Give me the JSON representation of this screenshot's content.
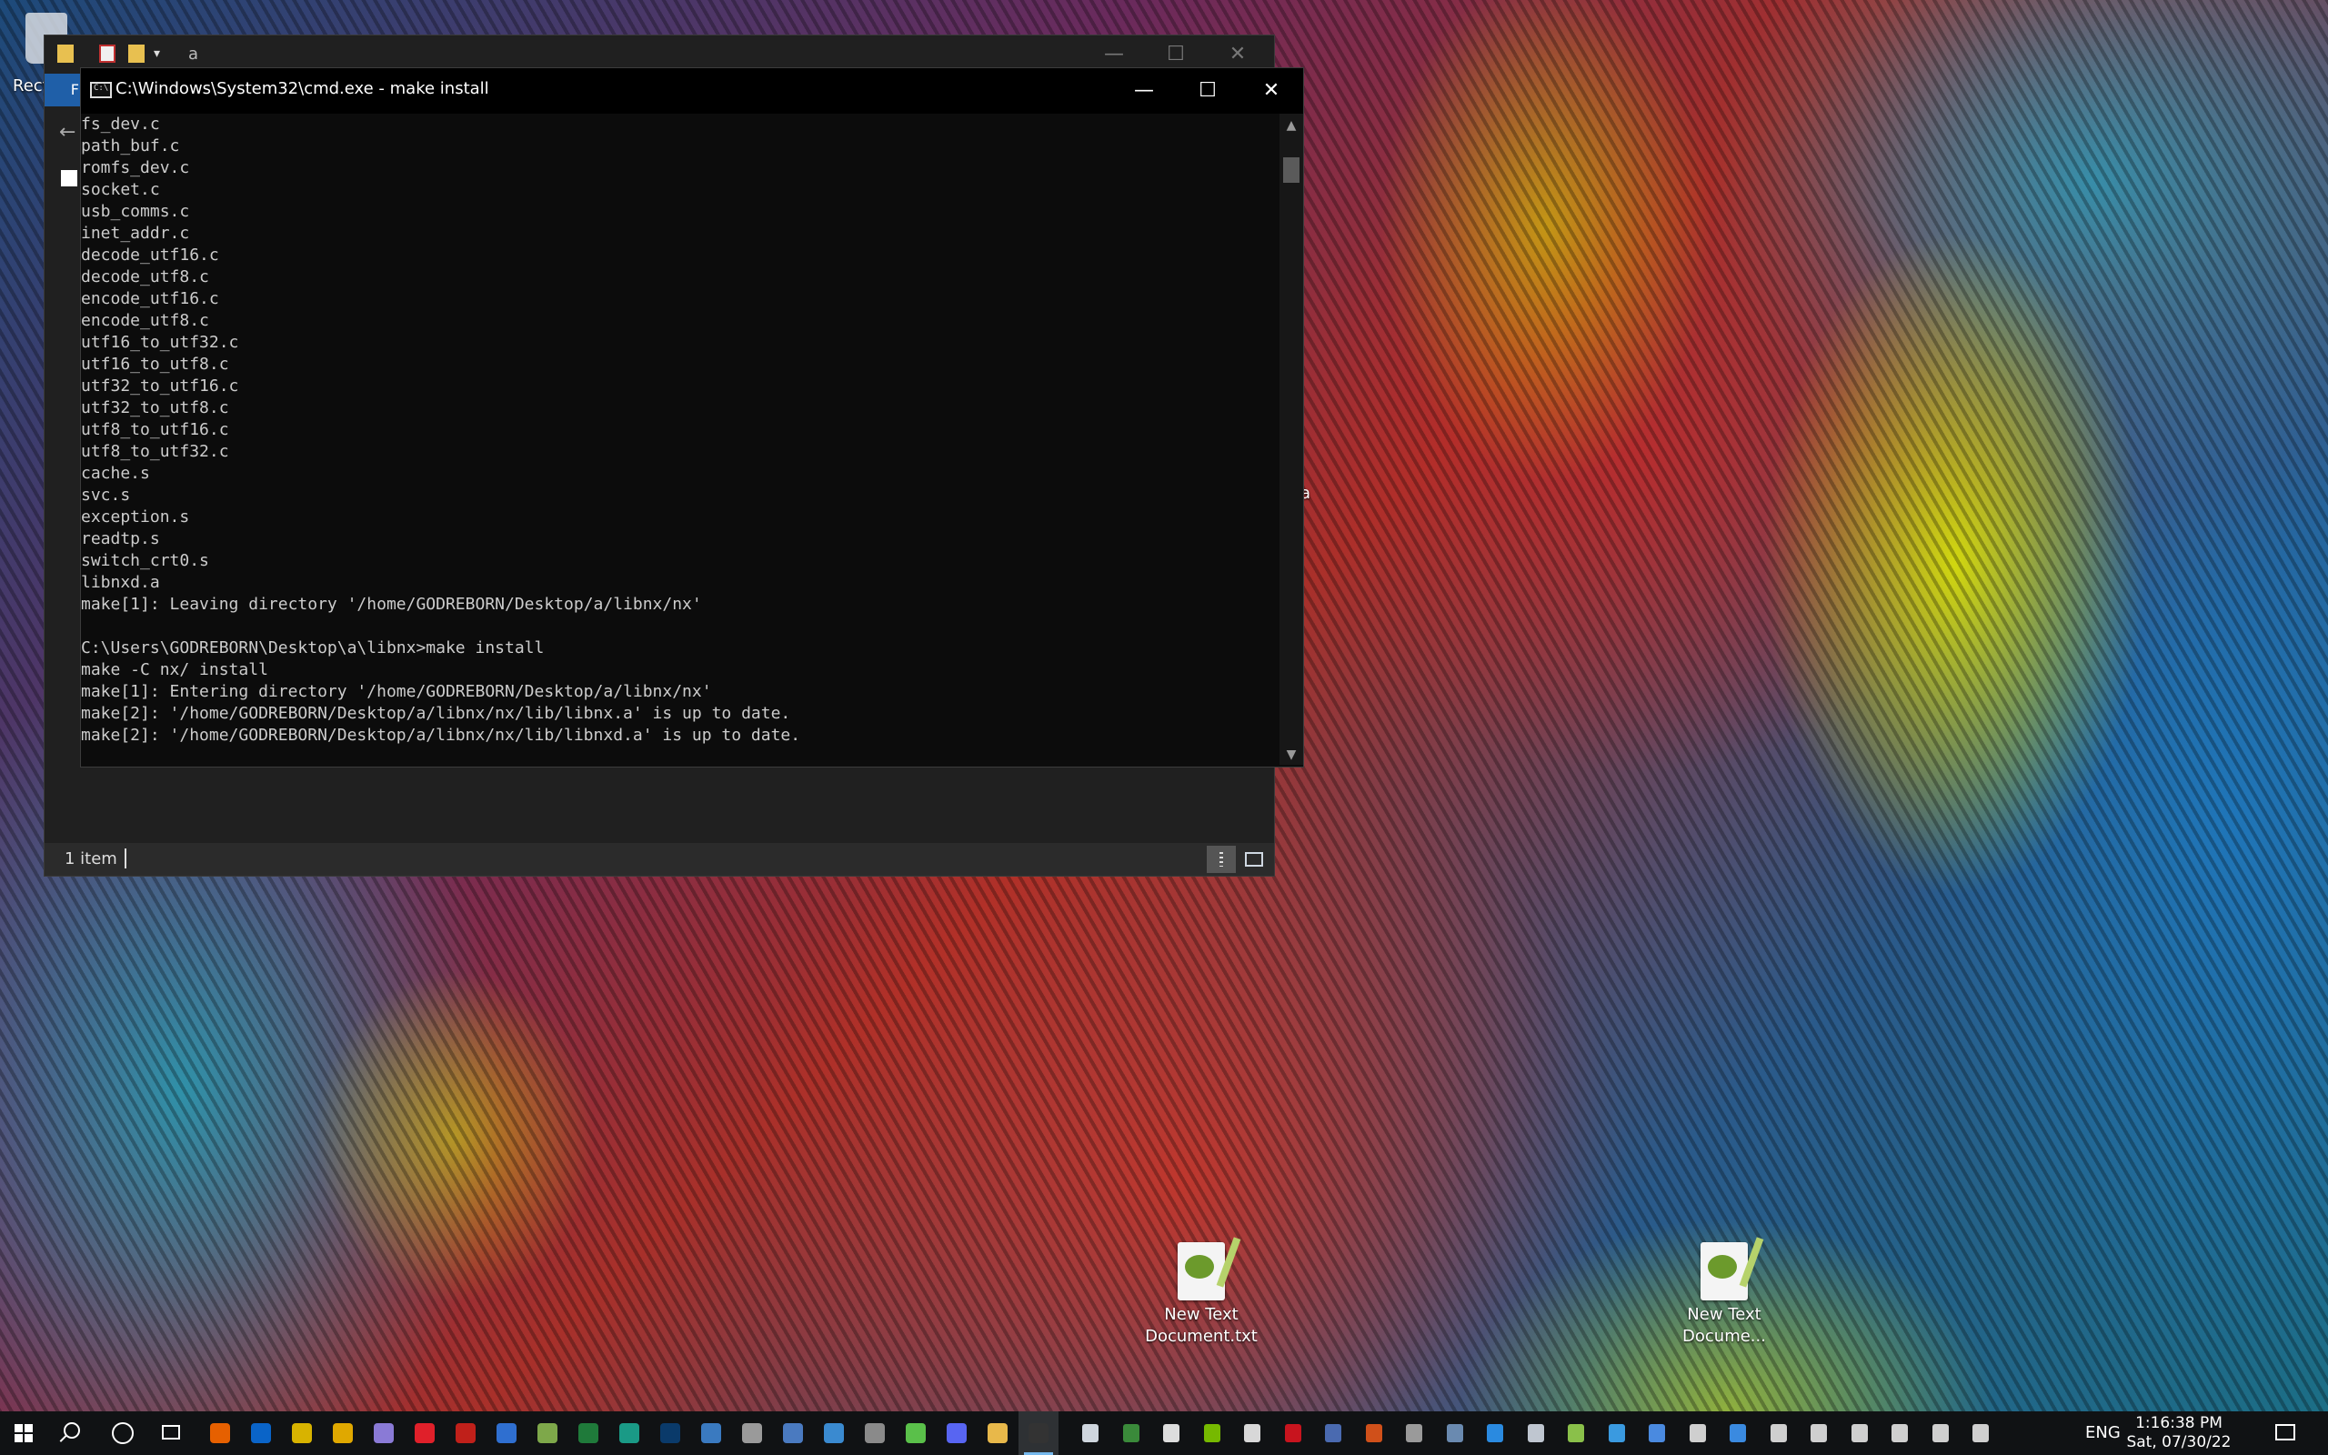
{
  "desktop": {
    "recycle_bin_label": "Recy",
    "icons": [
      {
        "label_line1": "New Text",
        "label_line2": "Document.txt"
      },
      {
        "label_line1": "New Text",
        "label_line2": "Docume..."
      }
    ],
    "folder_peek_label": "a"
  },
  "explorer": {
    "title": "a",
    "ribbon_tab": "F",
    "status_text": "1 item",
    "controls": {
      "minimize": "—",
      "maximize": "☐",
      "close": "✕"
    }
  },
  "cmd": {
    "title": "C:\\Windows\\System32\\cmd.exe - make  install",
    "controls": {
      "minimize": "—",
      "maximize": "☐",
      "close": "✕"
    },
    "lines": [
      "fs_dev.c",
      "path_buf.c",
      "romfs_dev.c",
      "socket.c",
      "usb_comms.c",
      "inet_addr.c",
      "decode_utf16.c",
      "decode_utf8.c",
      "encode_utf16.c",
      "encode_utf8.c",
      "utf16_to_utf32.c",
      "utf16_to_utf8.c",
      "utf32_to_utf16.c",
      "utf32_to_utf8.c",
      "utf8_to_utf16.c",
      "utf8_to_utf32.c",
      "cache.s",
      "svc.s",
      "exception.s",
      "readtp.s",
      "switch_crt0.s",
      "libnxd.a",
      "make[1]: Leaving directory '/home/GODREBORN/Desktop/a/libnx/nx'",
      "",
      "C:\\Users\\GODREBORN\\Desktop\\a\\libnx>make install",
      "make -C nx/ install",
      "make[1]: Entering directory '/home/GODREBORN/Desktop/a/libnx/nx'",
      "make[2]: '/home/GODREBORN/Desktop/a/libnx/nx/lib/libnx.a' is up to date.",
      "make[2]: '/home/GODREBORN/Desktop/a/libnx/nx/lib/libnxd.a' is up to date."
    ]
  },
  "taskbar": {
    "pinned": [
      {
        "name": "firefox-icon",
        "color": "#e66000"
      },
      {
        "name": "outlook-icon",
        "color": "#0a64c8"
      },
      {
        "name": "ai-icon",
        "color": "#d8b300"
      },
      {
        "name": "chrome-icon",
        "color": "#e0a800"
      },
      {
        "name": "rocket-icon",
        "color": "#8a7ad6"
      },
      {
        "name": "opera-icon",
        "color": "#e0202a"
      },
      {
        "name": "filezilla-icon",
        "color": "#c0201a"
      },
      {
        "name": "blue-app-icon",
        "color": "#2f6fd0"
      },
      {
        "name": "gear-app-icon",
        "color": "#7ea84a"
      },
      {
        "name": "excel-x-icon",
        "color": "#1f7a3a"
      },
      {
        "name": "monitor-app-icon",
        "color": "#1a9a86"
      },
      {
        "name": "photoshop-icon",
        "color": "#0a3a6a"
      },
      {
        "name": "remote-desktop-icon",
        "color": "#3a7ac0"
      },
      {
        "name": "keyboard-icon",
        "color": "#9a9a9a"
      },
      {
        "name": "calculator-icon",
        "color": "#4a7ac0"
      },
      {
        "name": "snipping-icon",
        "color": "#3a8ad0"
      },
      {
        "name": "cursor-app-icon",
        "color": "#8a8a8a"
      },
      {
        "name": "pen-app-icon",
        "color": "#5ac04a"
      },
      {
        "name": "discord-icon",
        "color": "#5865f2"
      },
      {
        "name": "file-explorer-icon",
        "color": "#e8b84a"
      },
      {
        "name": "cmd-icon",
        "color": "#333333"
      }
    ],
    "tray": [
      {
        "name": "onedrive-icon",
        "color": "#cfd6de"
      },
      {
        "name": "cpuid-icon",
        "color": "#3a8a3a"
      },
      {
        "name": "discord-tray-icon",
        "color": "#dddddd"
      },
      {
        "name": "nvidia-icon",
        "color": "#76b900"
      },
      {
        "name": "java-icon",
        "color": "#d8d8d8"
      },
      {
        "name": "adobe-icon",
        "color": "#c8141e"
      },
      {
        "name": "font-app-icon",
        "color": "#4a6ab0"
      },
      {
        "name": "ccleaner-icon",
        "color": "#d0501a"
      },
      {
        "name": "printer-icon",
        "color": "#9a9a9a"
      },
      {
        "name": "display-icon",
        "color": "#6a8ab0"
      },
      {
        "name": "bolt-icon",
        "color": "#2a8ae0"
      },
      {
        "name": "steam-icon",
        "color": "#bfc6d0"
      },
      {
        "name": "dots-icon",
        "color": "#8ac04a"
      },
      {
        "name": "lifebuoy-icon",
        "color": "#3a9ae0"
      },
      {
        "name": "globe-tray-icon",
        "color": "#4a8ae0"
      },
      {
        "name": "download-icon",
        "color": "#cfcfcf"
      },
      {
        "name": "bluetooth-icon",
        "color": "#3a8ae0"
      },
      {
        "name": "shield-icon",
        "color": "#cfcfcf"
      },
      {
        "name": "meet-icon",
        "color": "#cfcfcf"
      },
      {
        "name": "battery-icon",
        "color": "#cfcfcf"
      },
      {
        "name": "network-icon",
        "color": "#cfcfcf"
      },
      {
        "name": "volume-icon",
        "color": "#cfcfcf"
      },
      {
        "name": "usb-icon",
        "color": "#cfcfcf"
      }
    ],
    "language": "ENG",
    "time": "1:16:38 PM",
    "date": "Sat, 07/30/22"
  }
}
